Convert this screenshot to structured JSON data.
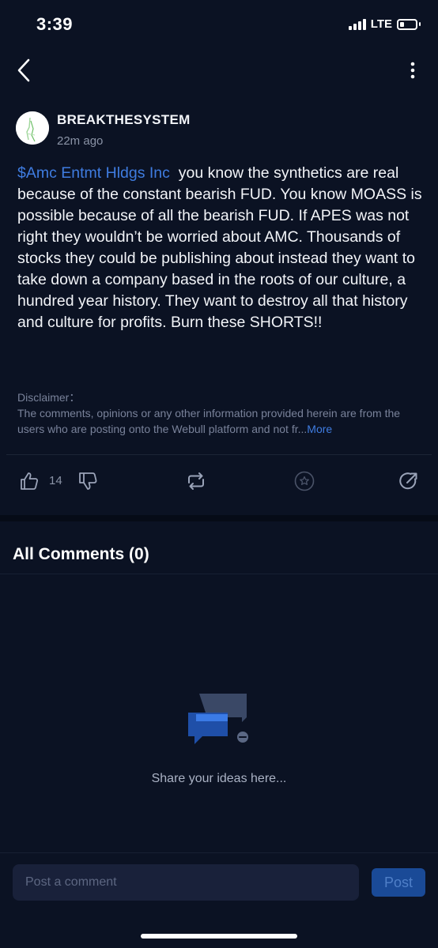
{
  "status_bar": {
    "time": "3:39",
    "network": "LTE"
  },
  "post": {
    "author": "BREAKTHESYSTEM",
    "time_ago": "22m ago",
    "ticker": "$Amc Entmt Hldgs Inc",
    "text": "you know the synthetics are real because of the constant bearish FUD. You know MOASS is possible because of all the bearish FUD. If APES was not right they wouldn’t be worried about AMC. Thousands of stocks they could be publishing about instead they want to take down a company based in the roots of our culture, a hundred year history. They want to destroy all that history and culture for profits. Burn these SHORTS!!"
  },
  "disclaimer": {
    "title": "Disclaimer：",
    "text": "The comments, opinions or any other information provided herein are from the users who are posting onto the Webull platform and not fr...",
    "more_label": "More"
  },
  "actions": {
    "like_count": "14",
    "icons": [
      "thumbs-up-icon",
      "thumbs-down-icon",
      "repost-icon",
      "star-icon",
      "share-icon"
    ]
  },
  "comments": {
    "title": "All Comments (0)",
    "empty_text": "Share your ideas here..."
  },
  "composer": {
    "placeholder": "Post a comment",
    "post_label": "Post"
  },
  "colors": {
    "background": "#0b1223",
    "accent": "#3f7ce0",
    "muted_text": "#79829a"
  }
}
